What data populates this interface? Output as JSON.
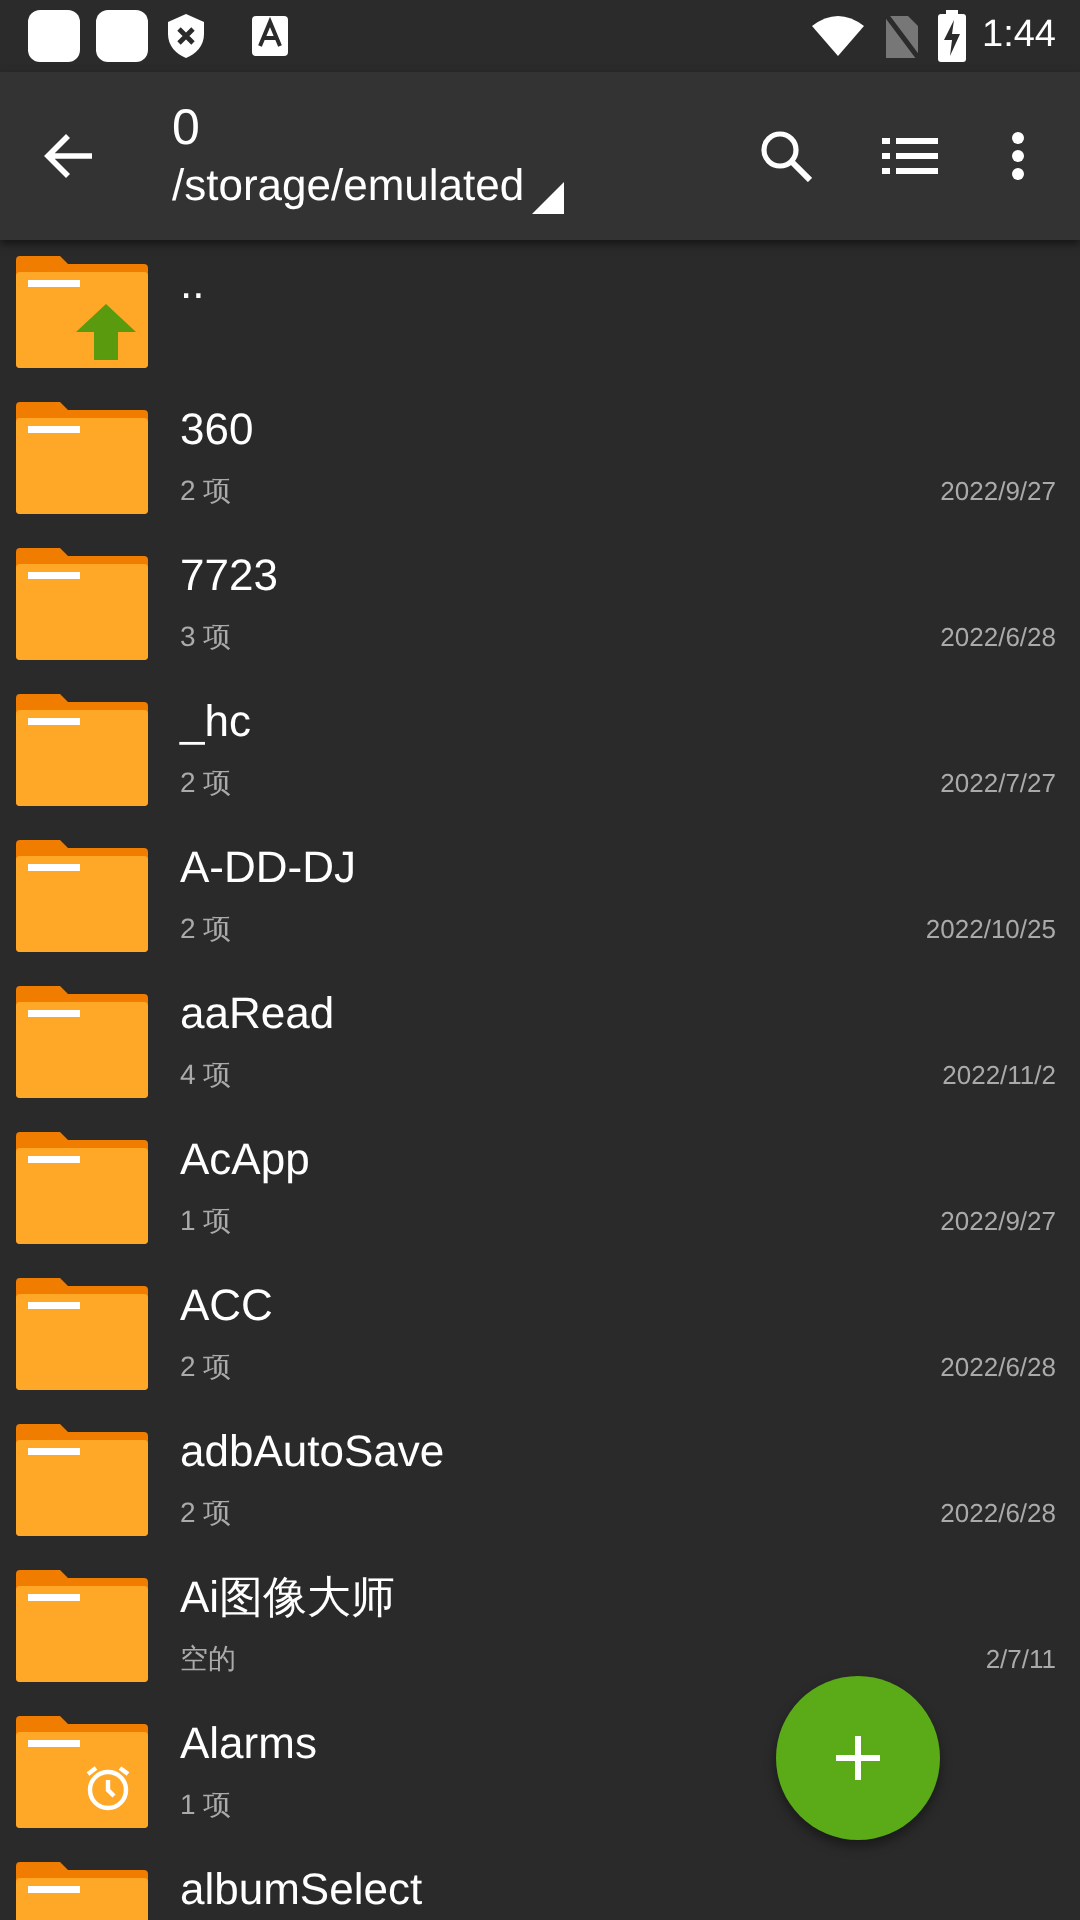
{
  "status_bar": {
    "time": "1:44"
  },
  "toolbar": {
    "title": "0",
    "path": "/storage/emulated"
  },
  "items": [
    {
      "kind": "up",
      "name": ".."
    },
    {
      "kind": "folder",
      "name": "360",
      "meta": "2 项",
      "date": "2022/9/27"
    },
    {
      "kind": "folder",
      "name": "7723",
      "meta": "3 项",
      "date": "2022/6/28"
    },
    {
      "kind": "folder",
      "name": "_hc",
      "meta": "2 项",
      "date": "2022/7/27"
    },
    {
      "kind": "folder",
      "name": "A-DD-DJ",
      "meta": "2 项",
      "date": "2022/10/25"
    },
    {
      "kind": "folder",
      "name": "aaRead",
      "meta": "4 项",
      "date": "2022/11/2"
    },
    {
      "kind": "folder",
      "name": "AcApp",
      "meta": "1 项",
      "date": "2022/9/27"
    },
    {
      "kind": "folder",
      "name": "ACC",
      "meta": "2 项",
      "date": "2022/6/28"
    },
    {
      "kind": "folder",
      "name": "adbAutoSave",
      "meta": "2 项",
      "date": "2022/6/28"
    },
    {
      "kind": "folder",
      "name": "Ai图像大师",
      "meta": "空的",
      "date": "2/7/11"
    },
    {
      "kind": "alarm",
      "name": "Alarms",
      "meta": "1 项"
    },
    {
      "kind": "folder",
      "name": "albumSelect"
    }
  ]
}
